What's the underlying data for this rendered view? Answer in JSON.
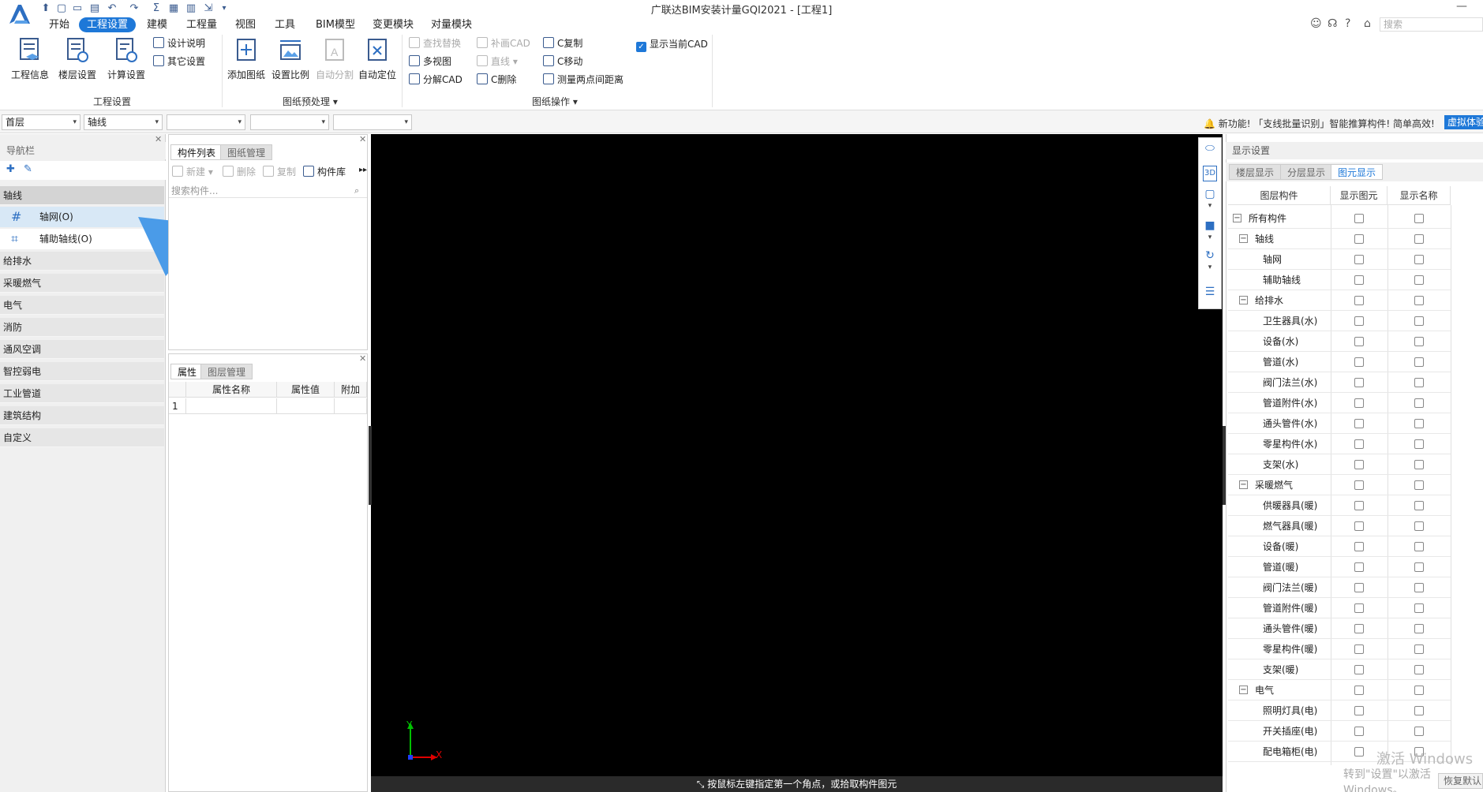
{
  "window": {
    "title": "广联达BIM安装计量GQI2021 - [工程1]"
  },
  "menu": [
    {
      "label": "开始"
    },
    {
      "label": "工程设置"
    },
    {
      "label": "建模"
    },
    {
      "label": "工程量"
    },
    {
      "label": "视图"
    },
    {
      "label": "工具"
    },
    {
      "label": "BIM模型"
    },
    {
      "label": "变更模块"
    },
    {
      "label": "对量模块"
    }
  ],
  "top_search": {
    "placeholder": "搜索"
  },
  "ribbon": {
    "group1": {
      "label": "工程设置",
      "buttons": [
        {
          "label": "工程信息"
        },
        {
          "label": "楼层设置"
        },
        {
          "label": "计算设置"
        }
      ],
      "small": [
        {
          "label": "设计说明"
        },
        {
          "label": "其它设置"
        }
      ]
    },
    "group2": {
      "label": "图纸预处理",
      "buttons": [
        {
          "label": "添加图纸"
        },
        {
          "label": "设置比例"
        },
        {
          "label": "自动分割"
        },
        {
          "label": "自动定位"
        }
      ]
    },
    "group3": {
      "label": "图纸操作",
      "small": [
        {
          "label": "查找替换"
        },
        {
          "label": "多视图"
        },
        {
          "label": "分解CAD"
        },
        {
          "label": "补画CAD"
        },
        {
          "label": "直线"
        },
        {
          "label": "C删除"
        },
        {
          "label": "C复制"
        },
        {
          "label": "C移动"
        },
        {
          "label": "测量两点间距离"
        }
      ],
      "show_cad": {
        "label": "显示当前CAD",
        "checked": true
      }
    }
  },
  "selectors": {
    "floor": "首层",
    "type": "轴线"
  },
  "notice": {
    "text": "新功能! 「支线批量识别」智能推算构件! 简单高效!",
    "button": "虚拟体验"
  },
  "nav": {
    "title": "导航栏",
    "sections": [
      {
        "label": "轴线"
      },
      {
        "label": "给排水"
      },
      {
        "label": "采暖燃气"
      },
      {
        "label": "电气"
      },
      {
        "label": "消防"
      },
      {
        "label": "通风空调"
      },
      {
        "label": "智控弱电"
      },
      {
        "label": "工业管道"
      },
      {
        "label": "建筑结构"
      },
      {
        "label": "自定义"
      }
    ],
    "items": [
      {
        "label": "轴网(O)"
      },
      {
        "label": "辅助轴线(O)"
      }
    ]
  },
  "comp_panel": {
    "tabs": [
      {
        "label": "构件列表"
      },
      {
        "label": "图纸管理"
      }
    ],
    "toolbar": {
      "new": "新建",
      "delete": "删除",
      "copy": "复制",
      "library": "构件库"
    },
    "search_placeholder": "搜索构件..."
  },
  "prop_panel": {
    "tabs": [
      {
        "label": "属性"
      },
      {
        "label": "图层管理"
      }
    ],
    "headers": [
      "属性名称",
      "属性值",
      "附加"
    ],
    "row1": "1"
  },
  "canvas": {
    "status": "按鼠标左键指定第一个角点，或拾取构件图元",
    "axis_x": "X",
    "axis_y": "Y"
  },
  "display_panel": {
    "title": "显示设置",
    "tabs": [
      {
        "label": "楼层显示"
      },
      {
        "label": "分层显示"
      },
      {
        "label": "图元显示"
      }
    ],
    "headers": [
      "图层构件",
      "显示图元",
      "显示名称"
    ],
    "rows": [
      {
        "label": "所有构件",
        "level": 0
      },
      {
        "label": "轴线",
        "level": 1
      },
      {
        "label": "轴网",
        "level": 2
      },
      {
        "label": "辅助轴线",
        "level": 2
      },
      {
        "label": "给排水",
        "level": 1
      },
      {
        "label": "卫生器具(水)",
        "level": 2
      },
      {
        "label": "设备(水)",
        "level": 2
      },
      {
        "label": "管道(水)",
        "level": 2
      },
      {
        "label": "阀门法兰(水)",
        "level": 2
      },
      {
        "label": "管道附件(水)",
        "level": 2
      },
      {
        "label": "通头管件(水)",
        "level": 2
      },
      {
        "label": "零星构件(水)",
        "level": 2
      },
      {
        "label": "支架(水)",
        "level": 2
      },
      {
        "label": "采暖燃气",
        "level": 1
      },
      {
        "label": "供暖器具(暖)",
        "level": 2
      },
      {
        "label": "燃气器具(暖)",
        "level": 2
      },
      {
        "label": "设备(暖)",
        "level": 2
      },
      {
        "label": "管道(暖)",
        "level": 2
      },
      {
        "label": "阀门法兰(暖)",
        "level": 2
      },
      {
        "label": "管道附件(暖)",
        "level": 2
      },
      {
        "label": "通头管件(暖)",
        "level": 2
      },
      {
        "label": "零星构件(暖)",
        "level": 2
      },
      {
        "label": "支架(暖)",
        "level": 2
      },
      {
        "label": "电气",
        "level": 1
      },
      {
        "label": "照明灯具(电)",
        "level": 2
      },
      {
        "label": "开关插座(电)",
        "level": 2
      },
      {
        "label": "配电箱柜(电)",
        "level": 2
      }
    ]
  },
  "watermark": {
    "line1": "激活 Windows",
    "line2": "转到\"设置\"以激活 Windows。"
  },
  "restore_button": "恢复默认"
}
